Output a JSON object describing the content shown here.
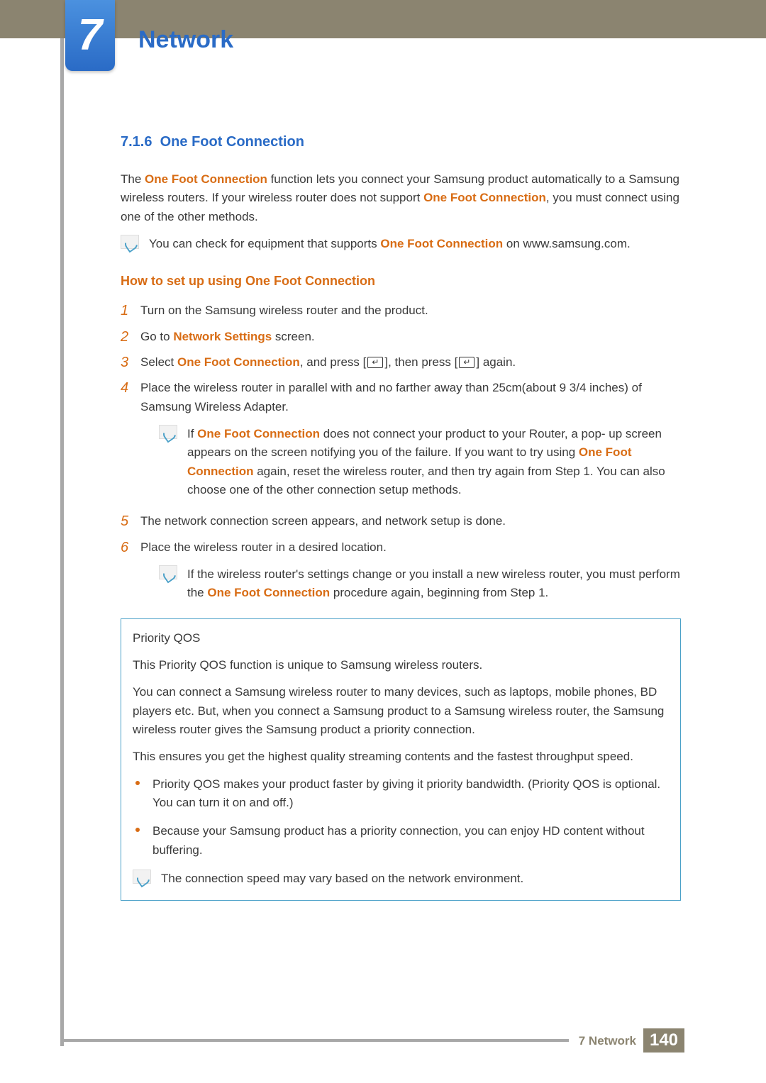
{
  "chapter": {
    "number": "7",
    "title": "Network"
  },
  "section": {
    "number": "7.1.6",
    "title": "One Foot Connection"
  },
  "intro": {
    "p1_a": "The ",
    "p1_b": "One Foot Connection",
    "p1_c": " function lets you connect your Samsung product automatically to a Samsung wireless routers. If your wireless router does not support ",
    "p1_d": "One Foot Connection",
    "p1_e": ", you must connect using one of the other methods."
  },
  "note1": {
    "a": "You can check for equipment that supports ",
    "b": "One Foot Connection",
    "c": " on www.samsung.com."
  },
  "howto_heading": "How to set up using One Foot Connection",
  "steps": {
    "s1": "Turn on the Samsung wireless router and the product.",
    "s2_a": "Go to ",
    "s2_b": "Network Settings",
    "s2_c": " screen.",
    "s3_a": "Select ",
    "s3_b": "One Foot Connection",
    "s3_c": ", and press [",
    "s3_d": "], then press [",
    "s3_e": "] again.",
    "s4": "Place the wireless router in parallel with and no farther away than 25cm(about 9 3/4 inches) of Samsung Wireless Adapter.",
    "s4_note_a": "If ",
    "s4_note_b": "One Foot Connection",
    "s4_note_c": " does not connect your product to your Router, a pop- up screen appears on the screen notifying you of the failure. If you want to try using ",
    "s4_note_d": "One Foot Connection",
    "s4_note_e": " again, reset the wireless router, and then try again from Step 1. You can also choose one of the other connection setup methods.",
    "s5": "The network connection screen appears, and network setup is done.",
    "s6": "Place the wireless router in a desired location.",
    "s6_note_a": "If the wireless router's settings change or you install a new wireless router, you must perform the ",
    "s6_note_b": "One Foot Connection",
    "s6_note_c": " procedure again, beginning from Step 1."
  },
  "qos": {
    "title": "Priority QOS",
    "p1": "This Priority QOS function is unique to Samsung wireless routers.",
    "p2": "You can connect a Samsung wireless router to many devices, such as laptops, mobile phones, BD players etc. But, when you connect a Samsung product to a Samsung wireless router, the Samsung wireless router gives the Samsung product a priority connection.",
    "p3": "This ensures you get the highest quality streaming contents and the fastest throughput speed.",
    "b1": "Priority QOS makes your product faster by giving it priority bandwidth. (Priority QOS is optional. You can turn it on and off.)",
    "b2": "Because your Samsung product has a priority connection, you can enjoy HD content without buffering.",
    "note": "The connection speed may vary based on the network environment."
  },
  "footer": {
    "label": "7 Network",
    "page": "140"
  }
}
